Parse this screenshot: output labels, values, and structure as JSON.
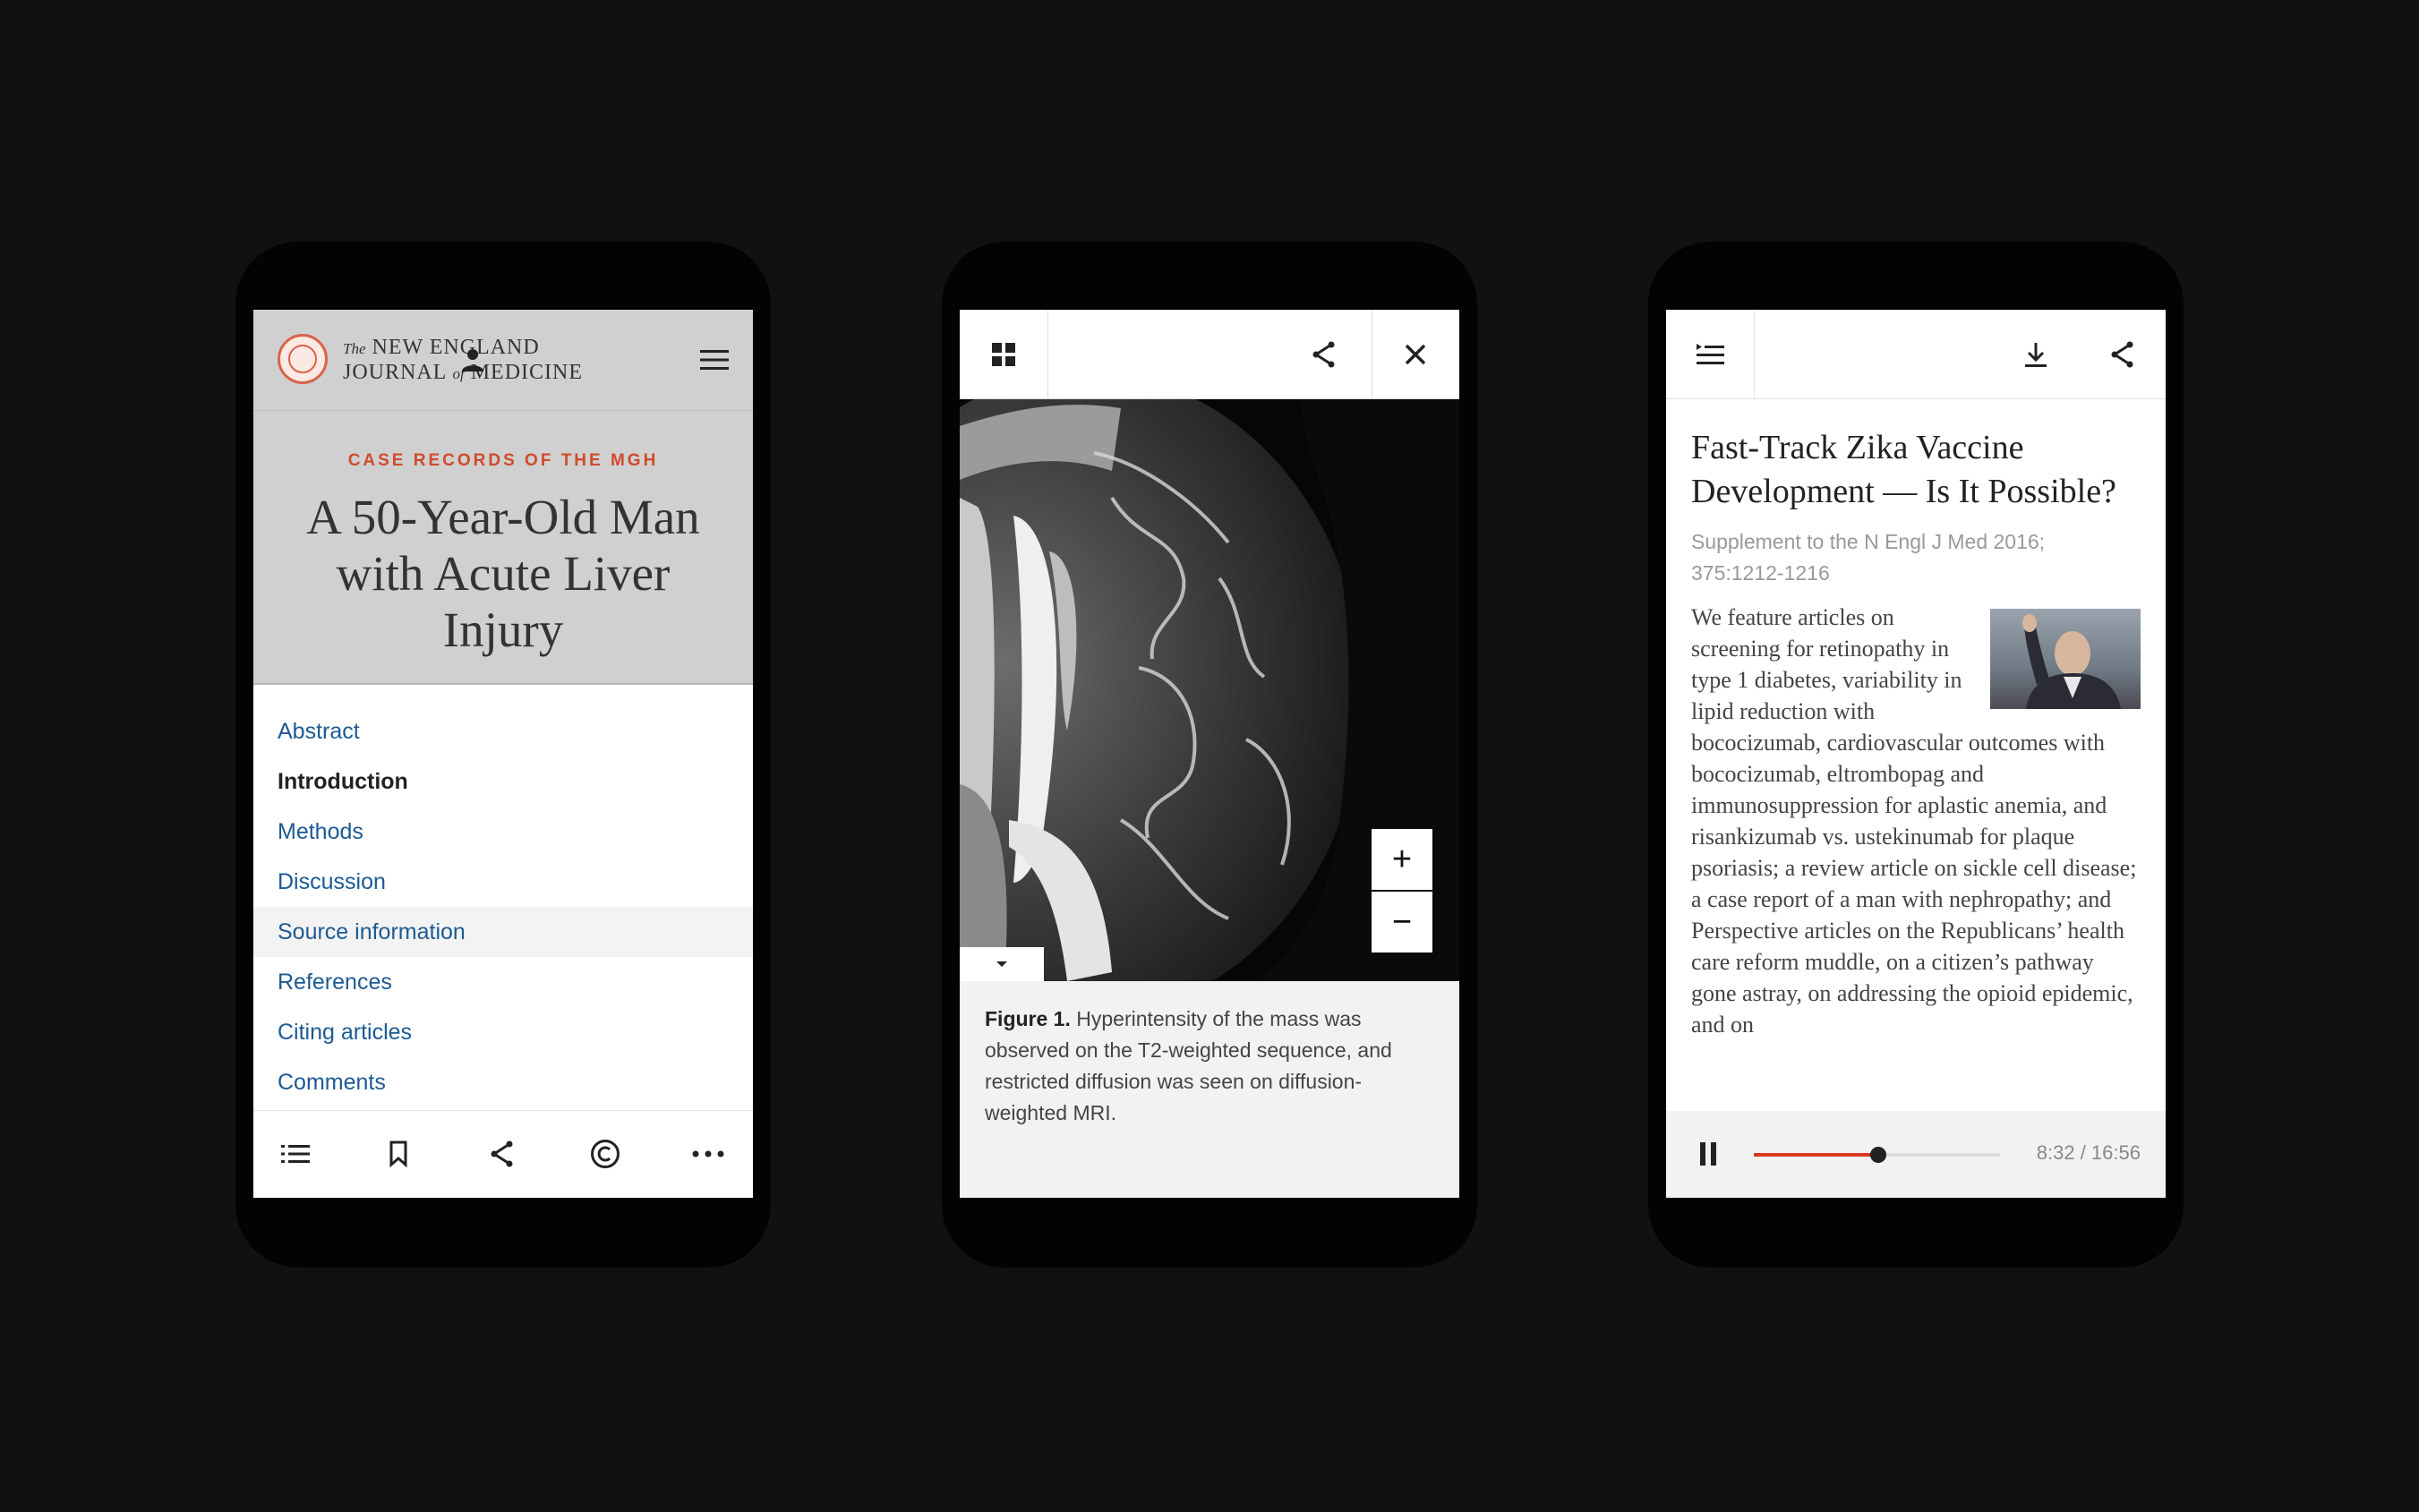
{
  "phone1": {
    "journal": {
      "line1_small": "The",
      "line1": "NEW ENGLAND",
      "line2a": "JOURNAL",
      "line2_small": "of",
      "line2b": "MEDICINE"
    },
    "kicker": "CASE RECORDS OF THE MGH",
    "title": "A 50-Year-Old Man with Acute Liver Injury",
    "toc": [
      "Abstract",
      "Introduction",
      "Methods",
      "Discussion",
      "Source information",
      "References",
      "Citing articles",
      "Comments"
    ],
    "active_toc": "Introduction",
    "highlighted_toc": "Source information",
    "bottom_icons": [
      "list-icon",
      "bookmark-icon",
      "share-icon",
      "copyright-icon",
      "more-icon"
    ]
  },
  "phone2": {
    "top_icons": [
      "grid-icon",
      "share-icon",
      "close-icon"
    ],
    "zoom_in": "+",
    "zoom_out": "−",
    "caption_label": "Figure 1.",
    "caption_text": "Hyperintensity of the mass was observed on the T2-weighted sequence, and restricted diffusion was seen on diffusion-weighted MRI."
  },
  "phone3": {
    "top_icons": [
      "playlist-icon",
      "download-icon",
      "share-icon"
    ],
    "title": "Fast-Track Zika Vaccine Development — Is It Possible?",
    "supplement": "Supplement to the N Engl J Med 2016; 375:1212-1216",
    "body": "We feature articles on screening for retinopathy in type 1 diabetes, variability in lipid reduction with bococizumab, cardiovascular outcomes with bococizumab, eltrombopag and immunosuppression for aplastic anemia, and risankizumab vs. ustekinumab for plaque psoriasis; a review article on sickle cell disease; a case report of a man with nephropathy; and Perspective articles on the Republicans’ health care reform muddle, on a citizen’s pathway gone astray, on addressing the opioid epidemic, and on",
    "player": {
      "elapsed": "8:32",
      "total": "16:56",
      "progress": 0.504,
      "time_label": "8:32 / 16:56"
    }
  },
  "colors": {
    "accent_red": "#d14a2b",
    "link_blue": "#1c5a93",
    "progress_red": "#d8391c",
    "background": "#121110"
  }
}
